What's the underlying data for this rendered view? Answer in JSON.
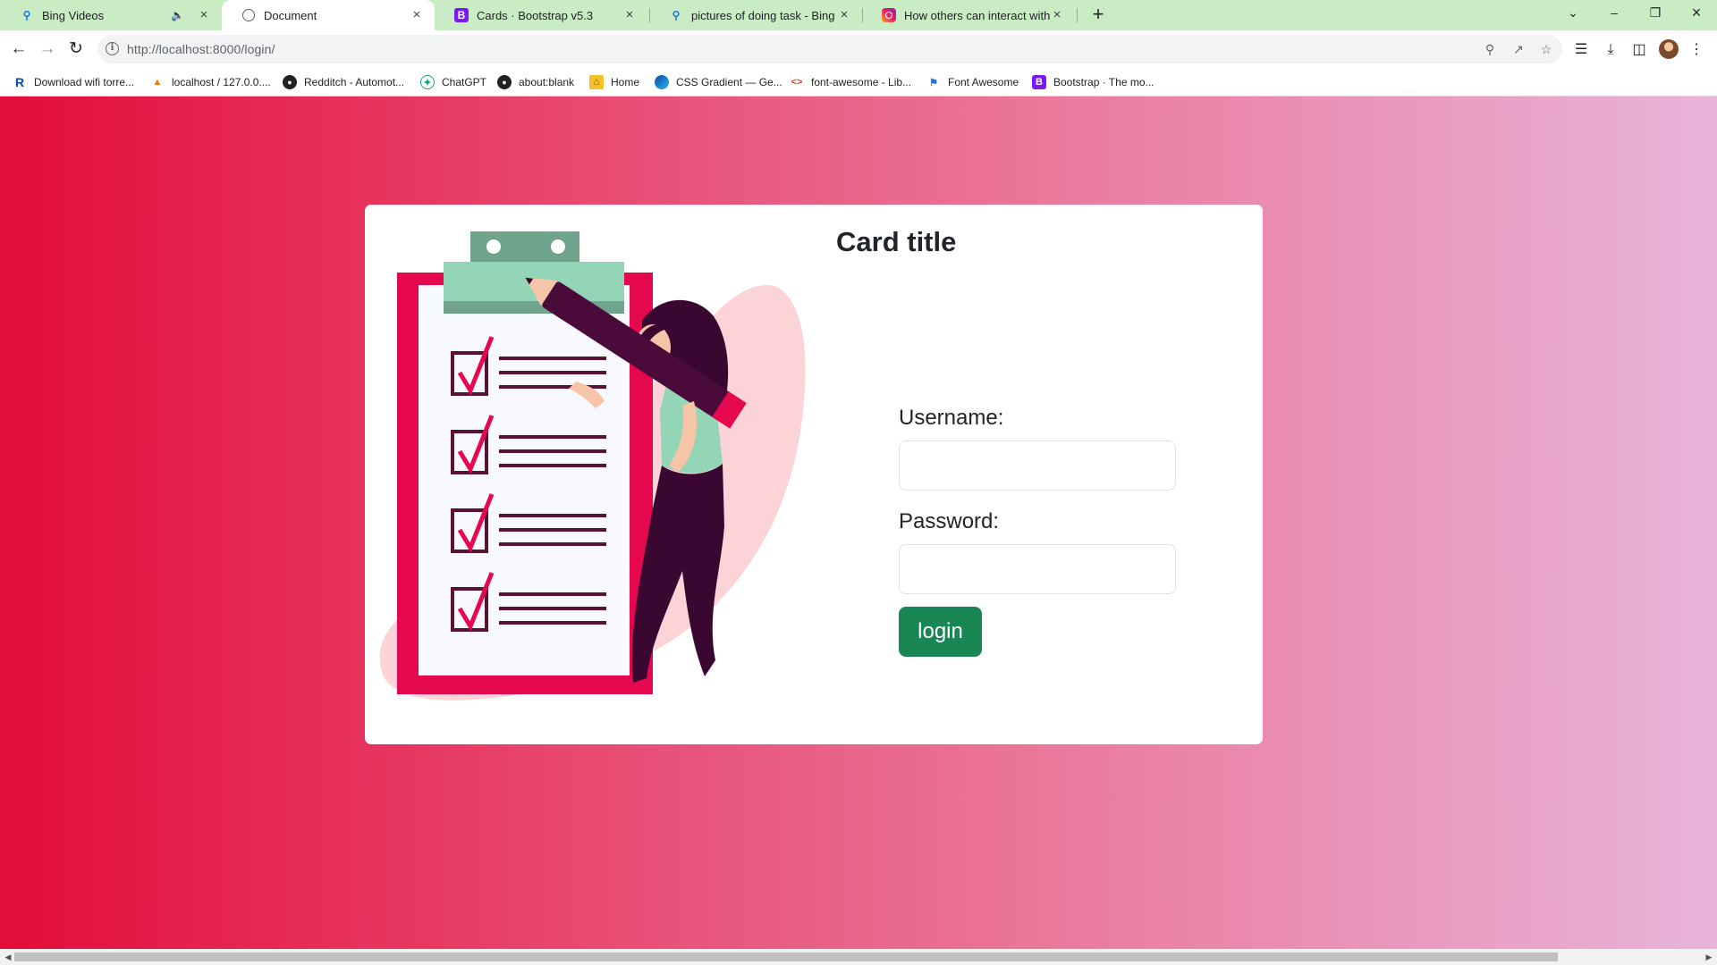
{
  "tabs": [
    {
      "title": "Bing Videos",
      "icon": "bing-search-icon",
      "muted": true
    },
    {
      "title": "Document",
      "icon": "globe-icon",
      "active": true
    },
    {
      "title": "Cards · Bootstrap v5.3",
      "icon": "bootstrap-icon"
    },
    {
      "title": "pictures of doing task - Bing ima",
      "icon": "bing-search-icon"
    },
    {
      "title": "How others can interact with yo",
      "icon": "instagram-icon"
    }
  ],
  "address_bar": {
    "url": "http://localhost:8000/login/"
  },
  "bookmarks": [
    {
      "label": "Download wifi torre...",
      "icon": "r-icon"
    },
    {
      "label": "localhost / 127.0.0....",
      "icon": "phpmyadmin-icon"
    },
    {
      "label": "Redditch - Automot...",
      "icon": "site-icon"
    },
    {
      "label": "ChatGPT",
      "icon": "chatgpt-icon"
    },
    {
      "label": "about:blank",
      "icon": "site-icon"
    },
    {
      "label": "Home",
      "icon": "home-icon"
    },
    {
      "label": "CSS Gradient — Ge...",
      "icon": "css-gradient-icon"
    },
    {
      "label": "font-awesome - Lib...",
      "icon": "code-icon"
    },
    {
      "label": "Font Awesome",
      "icon": "flag-icon"
    },
    {
      "label": "Bootstrap · The mo...",
      "icon": "bootstrap-icon"
    }
  ],
  "page": {
    "card_title": "Card title",
    "username_label": "Username:",
    "username_value": "",
    "password_label": "Password:",
    "password_value": "",
    "login_label": "login",
    "illustration": "woman-with-pencil-and-checklist-clipboard"
  },
  "colors": {
    "tabstrip": "#c9ecc5",
    "gradient_start": "#e30c3a",
    "gradient_end": "#e8b4da",
    "login_button": "#198754"
  }
}
